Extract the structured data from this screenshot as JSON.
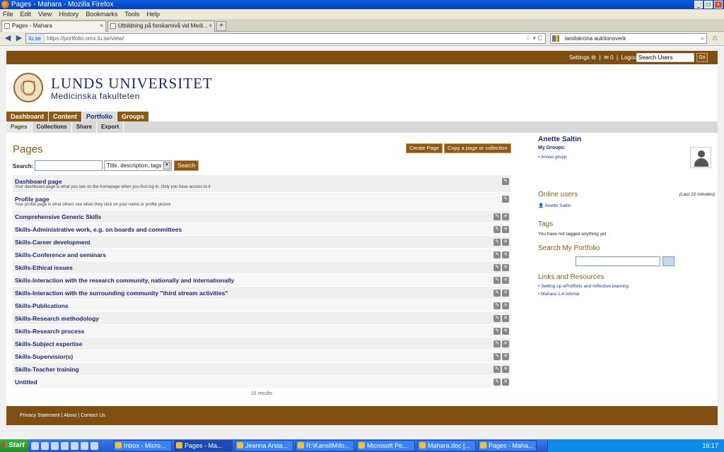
{
  "window": {
    "title": "Pages - Mahara - Mozilla Firefox"
  },
  "menu": [
    "File",
    "Edit",
    "View",
    "History",
    "Bookmarks",
    "Tools",
    "Help"
  ],
  "tabs": [
    {
      "label": "Pages - Mahara"
    },
    {
      "label": "Utbildning på forskarnivå vid Medi..."
    }
  ],
  "address": {
    "site": "lu.se",
    "url": "https://portfolio.omx.lu.se/view/"
  },
  "search_bar": {
    "value": "landskrona auktionsverk"
  },
  "header": {
    "settings": "Settings",
    "messages": "0",
    "logout": "Logout",
    "search_placeholder": "Search Users",
    "go": "Go",
    "university": "LUNDS UNIVERSITET",
    "faculty": "Medicinska fakulteten"
  },
  "main_tabs": [
    "Dashboard",
    "Content",
    "Portfolio",
    "Groups"
  ],
  "sub_tabs": [
    "Pages",
    "Collections",
    "Share",
    "Export"
  ],
  "main": {
    "title": "Pages",
    "create_btn": "Create Page",
    "copy_btn": "Copy a page or collection",
    "search_label": "Search:",
    "search_select": "Title, description, tags",
    "search_btn": "Search",
    "results": "16 results",
    "pages": [
      {
        "title": "Dashboard page",
        "desc": "Your dashboard page is what you see on the homepage when you first log in. Only you have access to it"
      },
      {
        "title": "Profile page",
        "desc": "Your profile page is what others see when they click on your name or profile picture"
      },
      {
        "title": "Comprehensive Generic Skills",
        "desc": ""
      },
      {
        "title": "Skills-Administrative work, e.g. on boards and committees",
        "desc": ""
      },
      {
        "title": "Skills-Career development",
        "desc": ""
      },
      {
        "title": "Skills-Conference and seminars",
        "desc": ""
      },
      {
        "title": "Skills-Ethical issues",
        "desc": ""
      },
      {
        "title": "Skills-Interaction with the research community, nationally and internationally",
        "desc": ""
      },
      {
        "title": "Skills-Interaction with the surrounding community \"third stream activities\"",
        "desc": ""
      },
      {
        "title": "Skills-Publications",
        "desc": ""
      },
      {
        "title": "Skills-Research methodology",
        "desc": ""
      },
      {
        "title": "Skills-Research process",
        "desc": ""
      },
      {
        "title": "Skills-Subject expertise",
        "desc": ""
      },
      {
        "title": "Skills-Supervisior(s)",
        "desc": ""
      },
      {
        "title": "Skills-Teacher training",
        "desc": ""
      },
      {
        "title": "Untitled",
        "desc": ""
      }
    ]
  },
  "sidebar": {
    "user": "Anette Saltin",
    "groups_label": "My Groups:",
    "group": "Annas grupp",
    "online_title": "Online users",
    "online_note": "(Last 10 minutes)",
    "online_user": "Anette Saltin",
    "tags_title": "Tags",
    "tags_text": "You have not tagged anything yet",
    "search_title": "Search My Portfolio",
    "links_title": "Links and Resources",
    "links": [
      "Setting up ePortfolio and reflective learning",
      "Mahara 1.4 tutorial"
    ]
  },
  "footer": {
    "text": "Privacy Statement  |  About  |  Contact Us"
  },
  "taskbar": {
    "start": "Start",
    "tasks": [
      "Inbox - Micro...",
      "Pages - Ma...",
      "Jeanna Arsta...",
      "R:\\KanslIM\\fo...",
      "Microsoft Po...",
      "Mahara.doc [...",
      "Pages - Maha..."
    ],
    "clock": "16:17"
  }
}
